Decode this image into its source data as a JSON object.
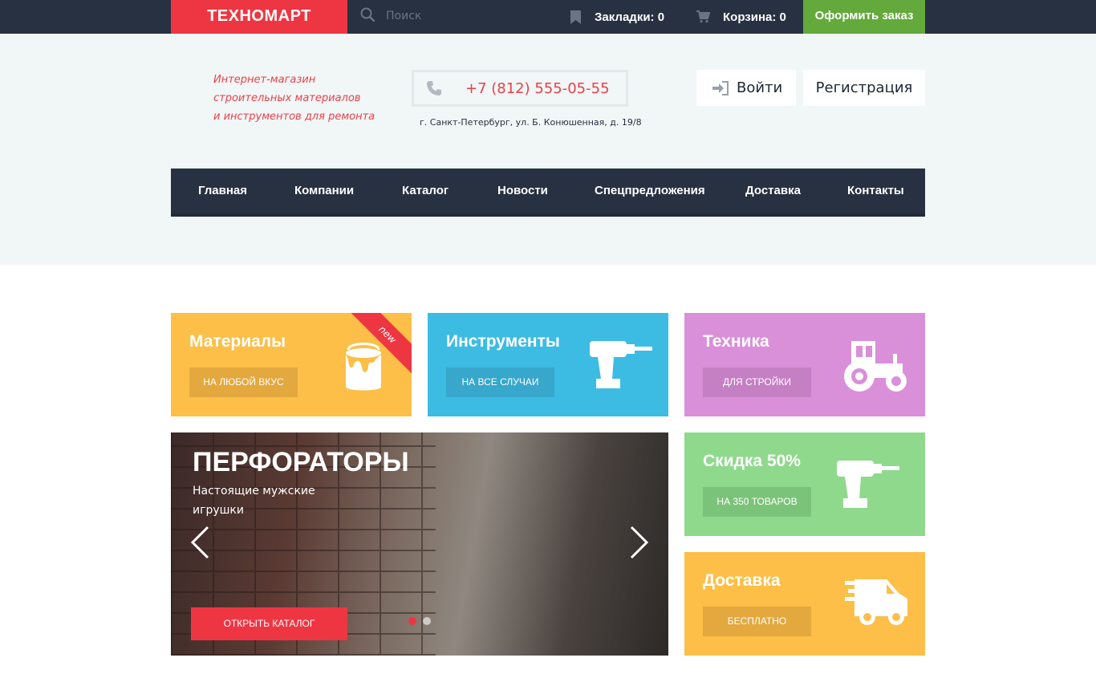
{
  "topbar": {
    "logo": "ТЕХНОМАРТ",
    "search_placeholder": "Поиск",
    "bookmarks": "Закладки: 0",
    "cart": "Корзина: 0",
    "checkout": "Оформить заказ"
  },
  "header": {
    "slogan": [
      "Интернет-магазин",
      "строительных материалов",
      "и инструментов для ремонта"
    ],
    "phone": "+7 (812) 555-05-55",
    "address": "г. Санкт-Петербург, ул. Б. Конюшенная, д. 19/8",
    "login": "Войти",
    "register": "Регистрация"
  },
  "nav": [
    "Главная",
    "Компании",
    "Каталог",
    "Новости",
    "Спецпредложения",
    "Доставка",
    "Контакты"
  ],
  "tiles": [
    {
      "title": "Материалы",
      "button": "На любой вкус",
      "badge": "new",
      "color": "#fdbf48",
      "button_color": "#e3a83e",
      "icon": "paint-bucket-icon"
    },
    {
      "title": "Инструменты",
      "button": "На все случаи",
      "color": "#3cbce3",
      "button_color": "#37a7cc",
      "icon": "drill-icon"
    },
    {
      "title": "Техника",
      "button": "Для стройки",
      "color": "#da8fd9",
      "button_color": "#c57fc3",
      "icon": "tractor-icon"
    },
    {
      "title": "Скидка 50%",
      "button": "На 350 товаров",
      "color": "#8fd98c",
      "button_color": "#7cc37a",
      "icon": "drill-icon"
    },
    {
      "title": "Доставка",
      "button": "Бесплатно",
      "color": "#fdbf48",
      "button_color": "#e3a83e",
      "icon": "delivery-truck-icon"
    }
  ],
  "slider": {
    "title": "ПЕРФОРАТОРЫ",
    "subtitle": "Настоящие мужские игрушки",
    "cta": "Открыть каталог"
  }
}
